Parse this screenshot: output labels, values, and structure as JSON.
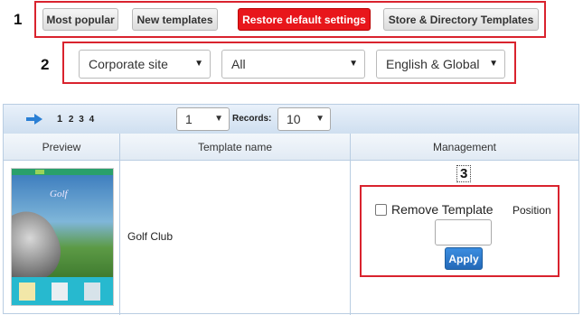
{
  "callouts": {
    "one": "1",
    "two": "2",
    "three": "3"
  },
  "top_buttons": {
    "most_popular": "Most popular",
    "new_templates": "New templates",
    "restore_defaults": "Restore default settings",
    "store_directory": "Store & Directory Templates"
  },
  "filters": {
    "site_type": "Corporate site",
    "category": "All",
    "language": "English & Global"
  },
  "pager": {
    "pages": [
      "1",
      "2",
      "3",
      "4"
    ],
    "current_page": "1",
    "page_select": "1",
    "records_label": "Records:",
    "records_select": "10"
  },
  "table": {
    "headers": {
      "preview": "Preview",
      "name": "Template name",
      "management": "Management"
    },
    "row": {
      "template_name": "Golf Club",
      "remove_label": "Remove Template",
      "position_label": "Position",
      "position_value": "",
      "apply_label": "Apply"
    }
  },
  "colors": {
    "accent_red": "#e8161b",
    "apply_blue": "#2a79c9",
    "grid_border": "#b9cde2"
  }
}
